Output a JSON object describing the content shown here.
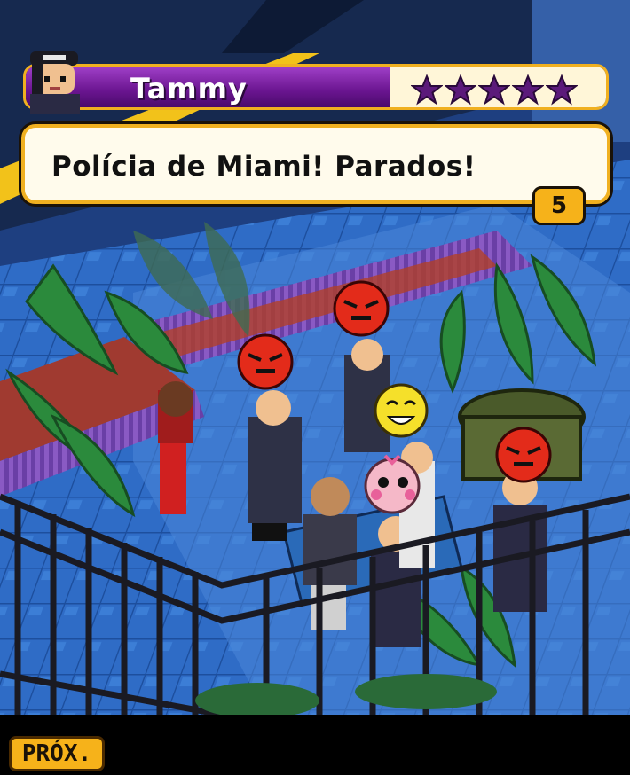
{
  "speaker": {
    "name": "Tammy",
    "rating_stars": 5,
    "rating_max": 5
  },
  "dialogue": {
    "text": "Polícia de Miami! Parados!",
    "remaining_count": "5"
  },
  "softkeys": {
    "next_label": "PRÓX."
  },
  "colors": {
    "banner_purple": "#6a1590",
    "accent_gold": "#f0b020",
    "police_uniform": "#2a2a44",
    "floor_blue": "#2f6cc6"
  },
  "emoticons": [
    "angry-face-icon",
    "angry-face-icon",
    "angry-face-icon",
    "laughing-face-icon",
    "blushing-face-icon"
  ]
}
